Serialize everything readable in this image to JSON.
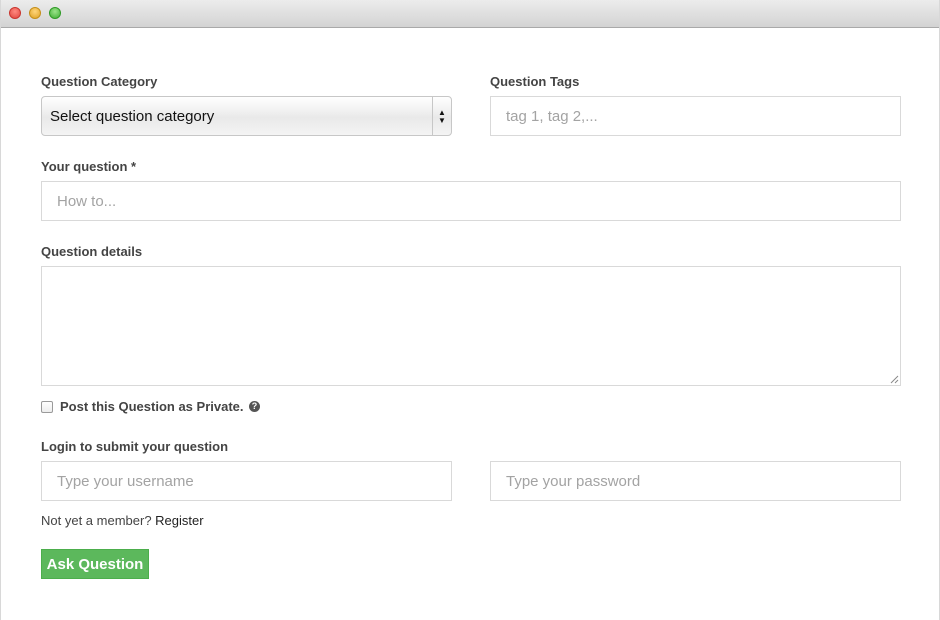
{
  "window": {
    "controls": [
      "close",
      "minimize",
      "zoom"
    ]
  },
  "form": {
    "category": {
      "label": "Question Category",
      "selected": "Select question category"
    },
    "tags": {
      "label": "Question Tags",
      "placeholder": "tag 1, tag 2,..."
    },
    "question": {
      "label": "Your question *",
      "placeholder": "How to..."
    },
    "details": {
      "label": "Question details"
    },
    "private": {
      "label": "Post this Question as Private.",
      "help_icon": "?"
    },
    "login": {
      "label": "Login to submit your question",
      "username_placeholder": "Type your username",
      "password_placeholder": "Type your password"
    },
    "member": {
      "text": "Not yet a member?",
      "register_link": "Register"
    },
    "submit_label": "Ask Question"
  },
  "colors": {
    "submit_bg": "#5cb85c",
    "label_text": "#444444",
    "placeholder_text": "#a3a3a3",
    "input_border": "#d9d9d9"
  }
}
